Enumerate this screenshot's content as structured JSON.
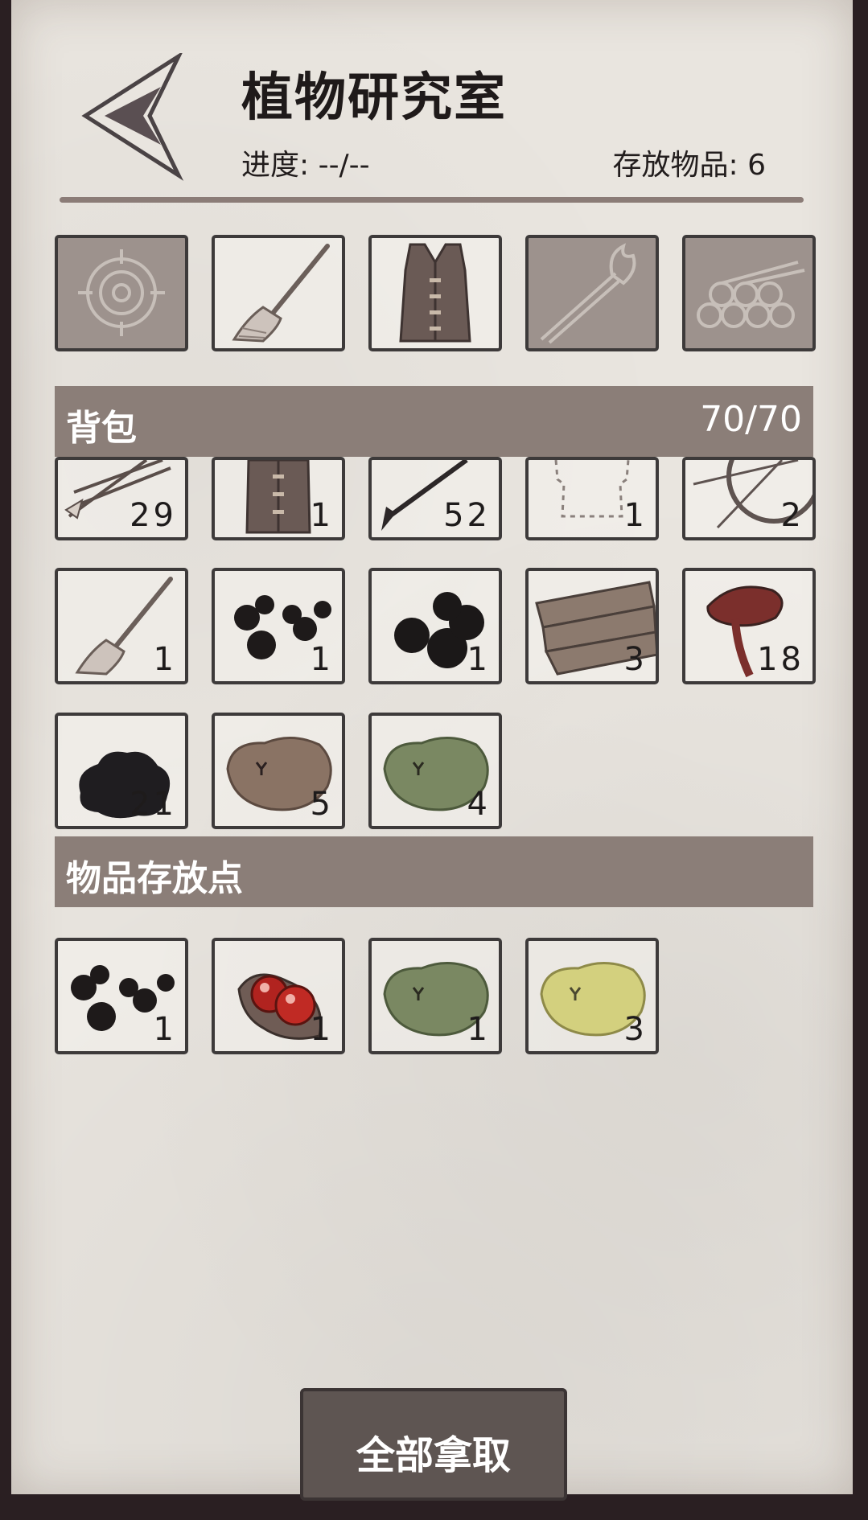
{
  "header": {
    "title": "植物研究室",
    "progress_label": "进度: --/--",
    "stored_label": "存放物品: 6"
  },
  "equipment_slots": [
    {
      "icon": "target-icon",
      "state": "locked"
    },
    {
      "icon": "broom-icon",
      "state": "equipped"
    },
    {
      "icon": "vest-icon",
      "state": "equipped"
    },
    {
      "icon": "torch-icon",
      "state": "locked"
    },
    {
      "icon": "logs-icon",
      "state": "locked"
    }
  ],
  "backpack": {
    "label": "背包",
    "capacity": "70/70",
    "items": [
      {
        "icon": "arrows-icon",
        "count": "29"
      },
      {
        "icon": "vest-icon",
        "count": "1"
      },
      {
        "icon": "spear-icon",
        "count": "52"
      },
      {
        "icon": "empty-shirt-icon",
        "count": "1"
      },
      {
        "icon": "bow-wheel-icon",
        "count": "2"
      },
      {
        "icon": "broom-icon",
        "count": "1"
      },
      {
        "icon": "black-berries-icon",
        "count": "1"
      },
      {
        "icon": "black-orbs-icon",
        "count": "1"
      },
      {
        "icon": "wood-planks-icon",
        "count": "3"
      },
      {
        "icon": "reishi-mushroom-icon",
        "count": "18"
      },
      {
        "icon": "black-fungus-icon",
        "count": "21"
      },
      {
        "icon": "brown-moss-icon",
        "count": "5"
      },
      {
        "icon": "green-moss-icon",
        "count": "4"
      }
    ]
  },
  "storage": {
    "label": "物品存放点",
    "items": [
      {
        "icon": "black-berries-icon",
        "count": "1"
      },
      {
        "icon": "red-berries-icon",
        "count": "1"
      },
      {
        "icon": "green-moss-icon",
        "count": "1"
      },
      {
        "icon": "yellow-moss-icon",
        "count": "3"
      }
    ]
  },
  "actions": {
    "take_all_label": "全部拿取"
  },
  "colors": {
    "paper": "#e9e5df",
    "banner": "#8b7e78",
    "slot_border": "#3d3a3a",
    "locked_slot": "#9d928d",
    "button": "#5e5552"
  }
}
